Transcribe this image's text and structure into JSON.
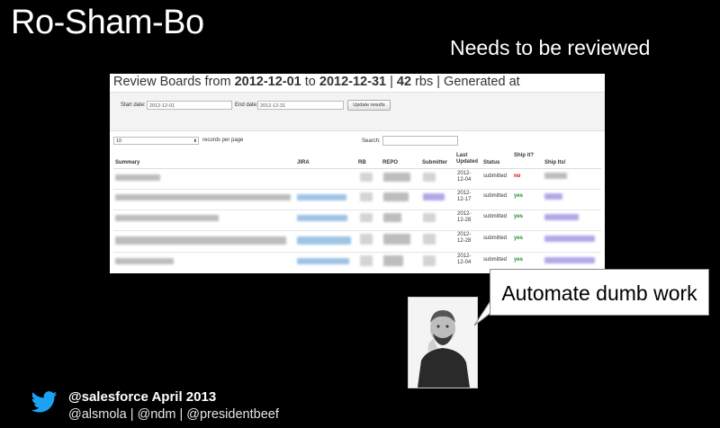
{
  "slide": {
    "title": "Ro-Sham-Bo",
    "callout_top": "Needs to be reviewed",
    "callout_bubble": "Automate dumb work",
    "footer_line1": "@salesforce April 2013",
    "footer_line2": "@alsmola | @ndm | @presidentbeef"
  },
  "report": {
    "title_prefix": "Review Boards from ",
    "start": "2012-12-01",
    "to": " to ",
    "end": "2012-12-31",
    "sep1": " | ",
    "count": "42",
    "rbs": " rbs",
    "sep2": " | Generated at",
    "start_label": "Start date:",
    "start_value": "2012-12-01",
    "end_label": "End date:",
    "end_value": "2012-12-31",
    "update_button": "Update results",
    "records_value": "10",
    "records_label": "records per page",
    "search_label": "Search:"
  },
  "table": {
    "columns": [
      "Summary",
      "JIRA",
      "RB",
      "REPO",
      "Submitter",
      "Last Updated",
      "Status",
      "Ship it?",
      "Ship Its!"
    ],
    "rows": [
      {
        "date": "2012-12-04",
        "status": "submitted",
        "ship": "no"
      },
      {
        "date": "2012-12-17",
        "status": "submitted",
        "ship": "yes"
      },
      {
        "date": "2012-12-28",
        "status": "submitted",
        "ship": "yes"
      },
      {
        "date": "2012-12-28",
        "status": "submitted",
        "ship": "yes"
      },
      {
        "date": "2012-12-04",
        "status": "submitted",
        "ship": "yes"
      }
    ]
  },
  "colors": {
    "background": "#000000",
    "no": "#dd0000",
    "yes": "#2a8a2a",
    "twitter": "#1da1f2"
  }
}
